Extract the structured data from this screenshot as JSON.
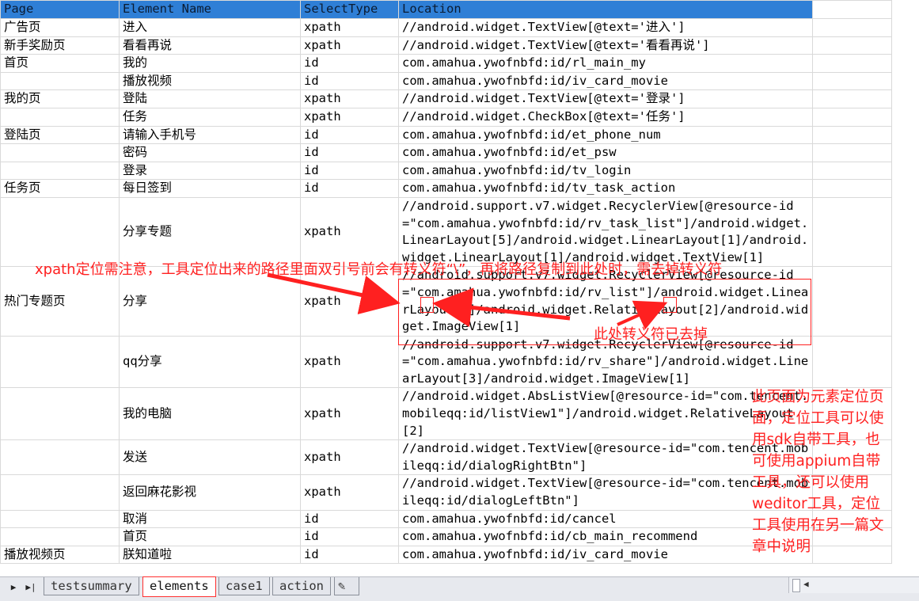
{
  "sheet": {
    "headers": [
      "Page",
      "Element Name",
      "SelectType",
      "Location"
    ],
    "rows": [
      {
        "page": "广告页",
        "name": "进入",
        "type": "xpath",
        "loc": "//android.widget.TextView[@text='进入']"
      },
      {
        "page": "新手奖励页",
        "name": "看看再说",
        "type": "xpath",
        "loc": "//android.widget.TextView[@text='看看再说']"
      },
      {
        "page": "首页",
        "name": "我的",
        "type": "id",
        "loc": "com.amahua.ywofnbfd:id/rl_main_my"
      },
      {
        "page": "",
        "name": "播放视频",
        "type": "id",
        "loc": "com.amahua.ywofnbfd:id/iv_card_movie"
      },
      {
        "page": "我的页",
        "name": "登陆",
        "type": "xpath",
        "loc": "//android.widget.TextView[@text='登录']"
      },
      {
        "page": "",
        "name": "任务",
        "type": "xpath",
        "loc": "//android.widget.CheckBox[@text='任务']"
      },
      {
        "page": "登陆页",
        "name": "请输入手机号",
        "type": "id",
        "loc": "com.amahua.ywofnbfd:id/et_phone_num"
      },
      {
        "page": "",
        "name": "密码",
        "type": "id",
        "loc": "com.amahua.ywofnbfd:id/et_psw"
      },
      {
        "page": "",
        "name": "登录",
        "type": "id",
        "loc": "com.amahua.ywofnbfd:id/tv_login"
      },
      {
        "page": "任务页",
        "name": "每日签到",
        "type": "id",
        "loc": "com.amahua.ywofnbfd:id/tv_task_action"
      },
      {
        "page": "",
        "name": "分享专题",
        "type": "xpath",
        "loc": "//android.support.v7.widget.RecyclerView[@resource-id=\"com.amahua.ywofnbfd:id/rv_task_list\"]/android.widget.LinearLayout[5]/android.widget.LinearLayout[1]/android.widget.LinearLayout[1]/android.widget.TextView[1]"
      },
      {
        "page": "热门专题页",
        "name": "分享",
        "type": "xpath",
        "loc": "//android.support.v7.widget.RecyclerView[@resource-id=\"com.amahua.ywofnbfd:id/rv_list\"]/android.widget.LinearLayout[1]/android.widget.RelativeLayout[2]/android.widget.ImageView[1]"
      },
      {
        "page": "",
        "name": "qq分享",
        "type": "xpath",
        "loc": "//android.support.v7.widget.RecyclerView[@resource-id=\"com.amahua.ywofnbfd:id/rv_share\"]/android.widget.LinearLayout[3]/android.widget.ImageView[1]"
      },
      {
        "page": "",
        "name": "我的电脑",
        "type": "xpath",
        "loc": "//android.widget.AbsListView[@resource-id=\"com.tencent.mobileqq:id/listView1\"]/android.widget.RelativeLayout[2]"
      },
      {
        "page": "",
        "name": "发送",
        "type": "xpath",
        "loc": "//android.widget.TextView[@resource-id=\"com.tencent.mobileqq:id/dialogRightBtn\"]"
      },
      {
        "page": "",
        "name": "返回麻花影视",
        "type": "xpath",
        "loc": "//android.widget.TextView[@resource-id=\"com.tencent.mobileqq:id/dialogLeftBtn\"]"
      },
      {
        "page": "",
        "name": "取消",
        "type": "id",
        "loc": "com.amahua.ywofnbfd:id/cancel"
      },
      {
        "page": "",
        "name": "首页",
        "type": "id",
        "loc": "com.amahua.ywofnbfd:id/cb_main_recommend"
      },
      {
        "page": "播放视频页",
        "name": "朕知道啦",
        "type": "id",
        "loc": "com.amahua.ywofnbfd:id/iv_card_movie"
      }
    ]
  },
  "annotations": {
    "xpath_note": "xpath定位需注意，工具定位出来的路径里面双引号前会有转义符“\\”，再将路径复制到此处时，需去掉转义符",
    "escape_removed": "此处转义符已去掉",
    "side_note": "此页面为元素定位页面，定位工具可以使用sdk自带工具，也可使用appium自带工具，还可以使用weditor工具，定位工具使用在另一篇文章中说明"
  },
  "tabs": {
    "items": [
      "testsummary",
      "elements",
      "case1",
      "action"
    ],
    "active": "elements"
  },
  "colors": {
    "header_fill": "#2f7fd6",
    "annotation_red": "#ff2020"
  }
}
